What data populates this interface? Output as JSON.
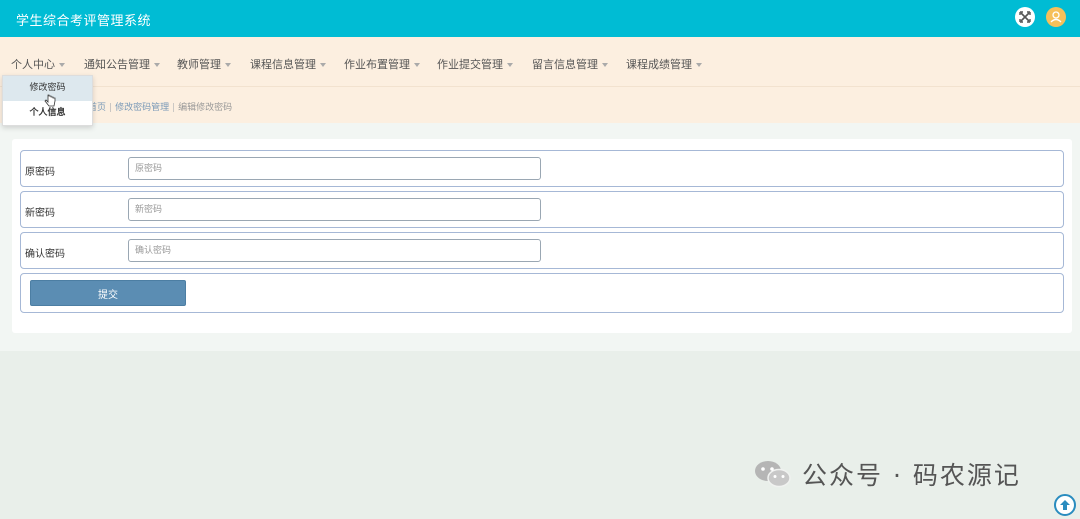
{
  "header": {
    "title": "学生综合考评管理系统",
    "icons": [
      "fullscreen-icon",
      "user-icon"
    ],
    "accent_color": "#00bcd4"
  },
  "nav": {
    "items": [
      {
        "label": "个人中心"
      },
      {
        "label": "通知公告管理"
      },
      {
        "label": "教师管理"
      },
      {
        "label": "课程信息管理"
      },
      {
        "label": "作业布置管理"
      },
      {
        "label": "作业提交管理"
      },
      {
        "label": "留言信息管理"
      },
      {
        "label": "课程成绩管理"
      }
    ]
  },
  "dropdown": {
    "items": [
      {
        "label": "修改密码"
      },
      {
        "label": "个人信息"
      }
    ]
  },
  "breadcrumb": {
    "home": "首页",
    "parent": "修改密码管理",
    "current": "编辑修改密码"
  },
  "form": {
    "fields": [
      {
        "label": "原密码",
        "placeholder": "原密码",
        "value": ""
      },
      {
        "label": "新密码",
        "placeholder": "新密码",
        "value": ""
      },
      {
        "label": "确认密码",
        "placeholder": "确认密码",
        "value": ""
      }
    ],
    "submit_label": "提交"
  },
  "watermark": {
    "text": "公众号 · 码农源记"
  }
}
